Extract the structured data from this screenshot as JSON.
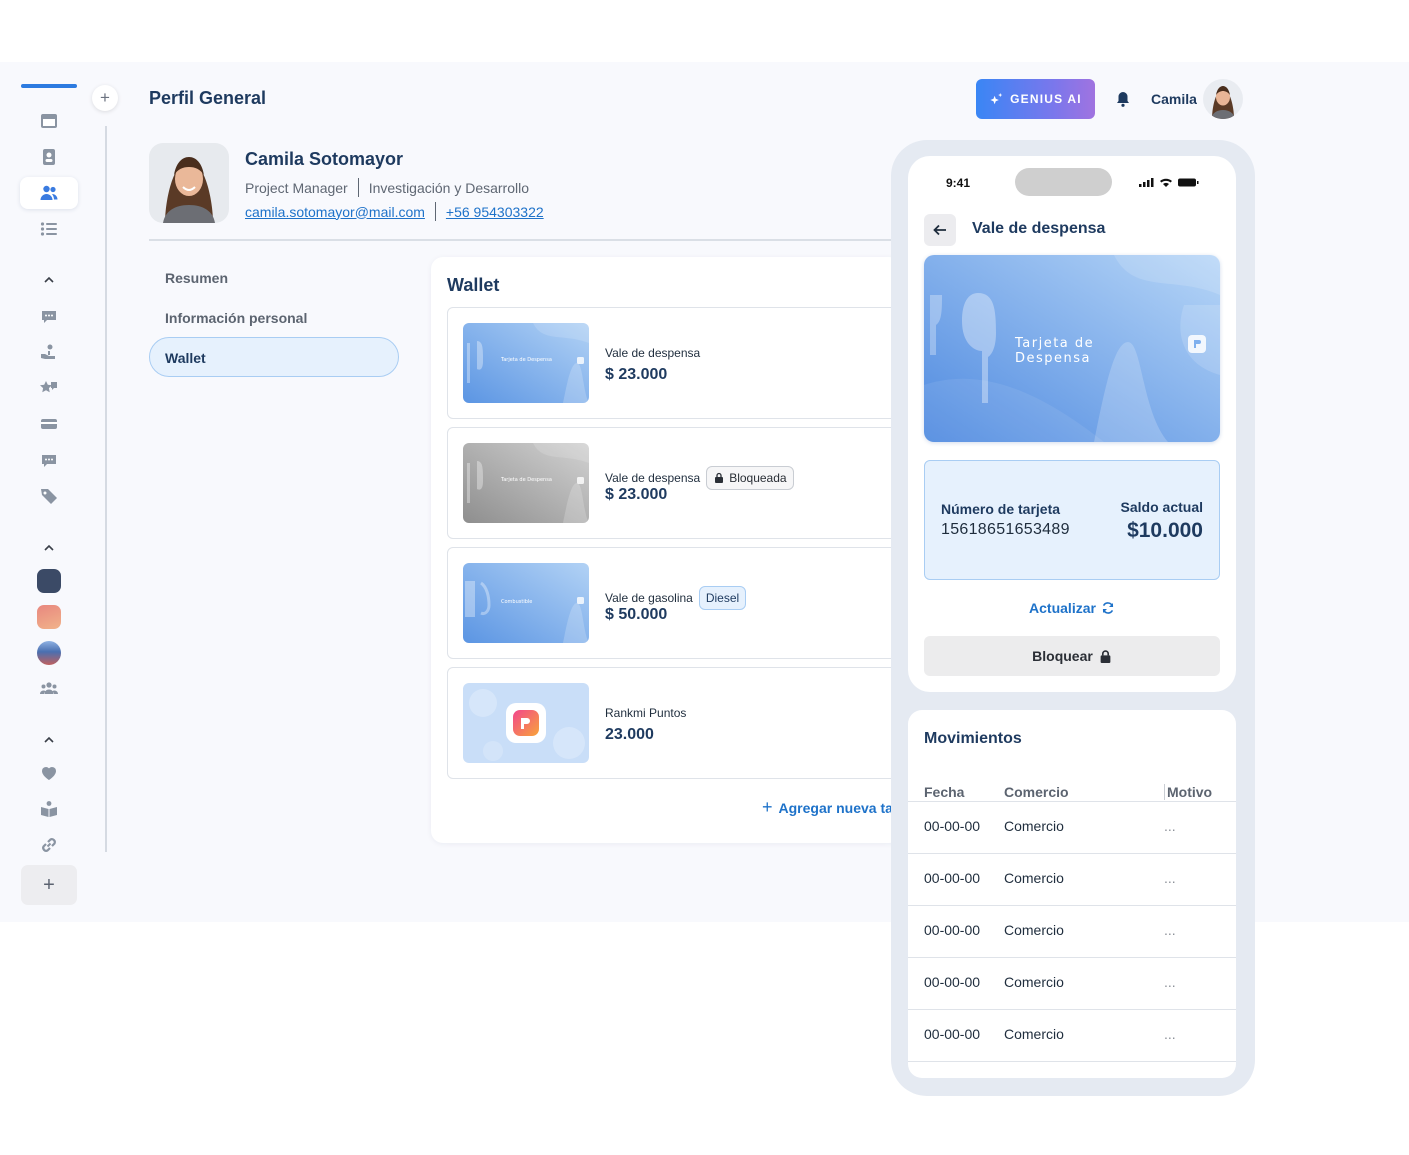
{
  "header": {
    "page_title": "Perfil General",
    "genius_label": "GENIUS AI",
    "user_name": "Camila"
  },
  "profile": {
    "name": "Camila Sotomayor",
    "role": "Project Manager",
    "department": "Investigación y Desarrollo",
    "email": "camila.sotomayor@mail.com",
    "phone": "+56 954303322"
  },
  "side_nav": {
    "items": [
      {
        "label": "Resumen"
      },
      {
        "label": "Información personal"
      },
      {
        "label": "Wallet",
        "active": true
      }
    ]
  },
  "wallet": {
    "title": "Wallet",
    "cards": [
      {
        "label": "Vale de despensa",
        "value": "$ 23.000",
        "thumb_text": "Tarjeta de Despensa"
      },
      {
        "label": "Vale de despensa",
        "value": "$ 23.000",
        "badge": "Bloqueada",
        "thumb_text": "Tarjeta de Despensa"
      },
      {
        "label": "Vale de gasolina",
        "value": "$ 50.000",
        "badge": "Diesel",
        "thumb_text": "Combustible"
      },
      {
        "label": "Rankmi Puntos",
        "value": "23.000"
      }
    ],
    "add_label": "Agregar nueva tarjeta"
  },
  "phone": {
    "time": "9:41",
    "title": "Vale de despensa",
    "card_text_line1": "Tarjeta de",
    "card_text_line2": "Despensa",
    "number_label": "Número de tarjeta",
    "number": "15618651653489",
    "balance_label": "Saldo actual",
    "balance": "$10.000",
    "refresh_label": "Actualizar",
    "block_label": "Bloquear"
  },
  "movements": {
    "title": "Movimientos",
    "columns": [
      "Fecha",
      "Comercio",
      "Motivo"
    ],
    "rows": [
      [
        "00-00-00",
        "Comercio",
        "..."
      ],
      [
        "00-00-00",
        "Comercio",
        "..."
      ],
      [
        "00-00-00",
        "Comercio",
        "..."
      ],
      [
        "00-00-00",
        "Comercio",
        "..."
      ],
      [
        "00-00-00",
        "Comercio",
        "..."
      ]
    ]
  },
  "colors": {
    "primary": "#1e72c9",
    "navy": "#1e3a5f",
    "card_blue": "#5b95e3",
    "active_bg": "#e6f1fd"
  },
  "icons": {
    "rail": [
      "calendar-icon",
      "contact-card-icon",
      "people-icon",
      "list-icon",
      "chevron-up-icon",
      "chat-icon",
      "hand-coin-icon",
      "star-chat-icon",
      "credit-card-icon",
      "chat-icon",
      "tag-icon",
      "chevron-up-icon",
      "app-thumbnail-icon",
      "app-thumbnail-icon",
      "app-thumbnail-icon",
      "group-icon",
      "chevron-up-icon",
      "heart-icon",
      "book-icon",
      "link-icon",
      "plus-icon"
    ]
  }
}
